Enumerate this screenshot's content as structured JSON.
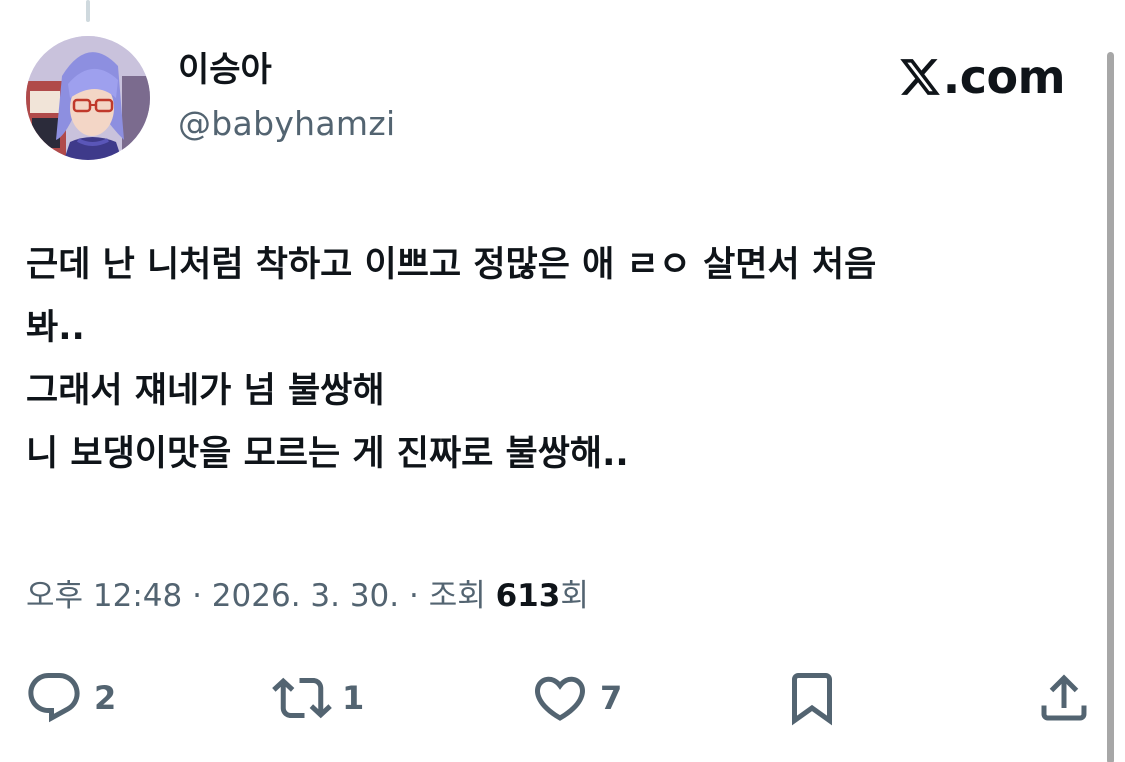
{
  "author": {
    "display_name": "이승아",
    "handle": "@babyhamzi"
  },
  "brand": {
    "text": ".com",
    "logo_icon": "x-logo-icon"
  },
  "tweet": {
    "lines": [
      "근데 난 니처럼 착하고 이쁘고 정많은 애 ㄹㅇ 살면서 처음",
      "봐..",
      "그래서 쟤네가 넘 불쌍해",
      "니 보댕이맛을 모르는 게 진짜로 불쌍해.."
    ]
  },
  "meta": {
    "time": "오후 12:48",
    "separator": " · ",
    "date": "2026. 3. 30.",
    "views_label": "조회",
    "views_count": "613",
    "views_suffix": "회"
  },
  "actions": {
    "reply": {
      "icon": "reply-icon",
      "count": "2"
    },
    "repost": {
      "icon": "repost-icon",
      "count": "1"
    },
    "like": {
      "icon": "heart-icon",
      "count": "7"
    },
    "bookmark": {
      "icon": "bookmark-icon"
    },
    "share": {
      "icon": "share-icon"
    }
  },
  "colors": {
    "text_primary": "#0f1419",
    "text_secondary": "#536471",
    "background": "#ffffff"
  }
}
